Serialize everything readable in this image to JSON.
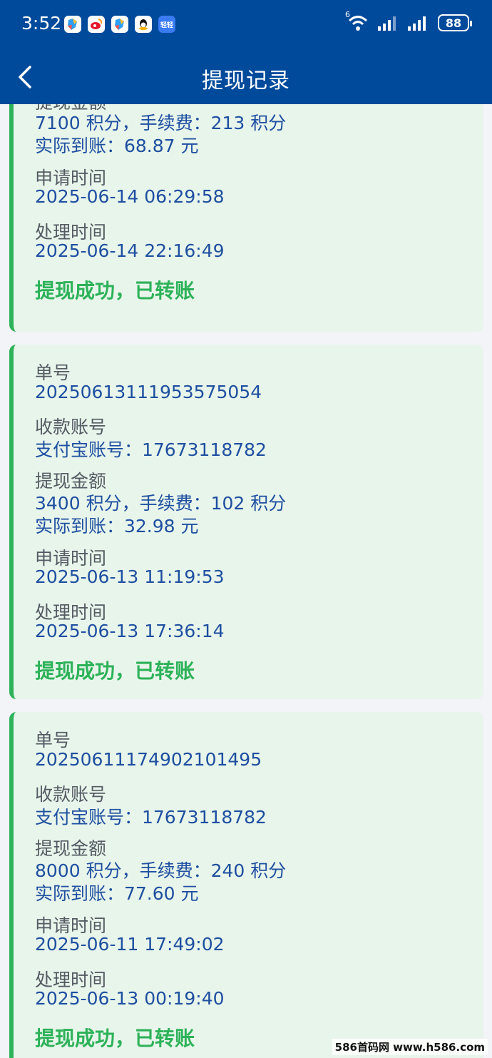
{
  "status": {
    "time": "3:52",
    "apps": [
      "app-1",
      "weibo",
      "app-2",
      "qq",
      "tt"
    ],
    "app_badge_text": "轻轻",
    "network": "6",
    "battery": "88"
  },
  "nav": {
    "title": "提现记录"
  },
  "labels": {
    "order": "单号",
    "account": "收款账号",
    "amount": "提现金额",
    "apply_time": "申请时间",
    "process_time": "处理时间"
  },
  "records": [
    {
      "order_no": "",
      "account": "",
      "amount": "7100 积分，手续费：213 积分",
      "received": "实际到账：68.87 元",
      "apply_time": "2025-06-14 06:29:58",
      "process_time": "2025-06-14 22:16:49",
      "status": "提现成功，已转账"
    },
    {
      "order_no": "20250613111953575054",
      "account": "支付宝账号：17673118782",
      "amount": "3400 积分，手续费：102 积分",
      "received": "实际到账：32.98 元",
      "apply_time": "2025-06-13 11:19:53",
      "process_time": "2025-06-13 17:36:14",
      "status": "提现成功，已转账"
    },
    {
      "order_no": "20250611174902101495",
      "account": "支付宝账号：17673118782",
      "amount": "8000 积分，手续费：240 积分",
      "received": "实际到账：77.60 元",
      "apply_time": "2025-06-11 17:49:02",
      "process_time": "2025-06-13 00:19:40",
      "status": "提现成功，已转账"
    }
  ],
  "watermark": "586首码网 www.h586.com",
  "colors": {
    "header": "#004a9b",
    "card_bg": "#e8f5eb",
    "accent_green": "#2db259",
    "value_blue": "#1e4fa0",
    "label_gray": "#555a63"
  }
}
